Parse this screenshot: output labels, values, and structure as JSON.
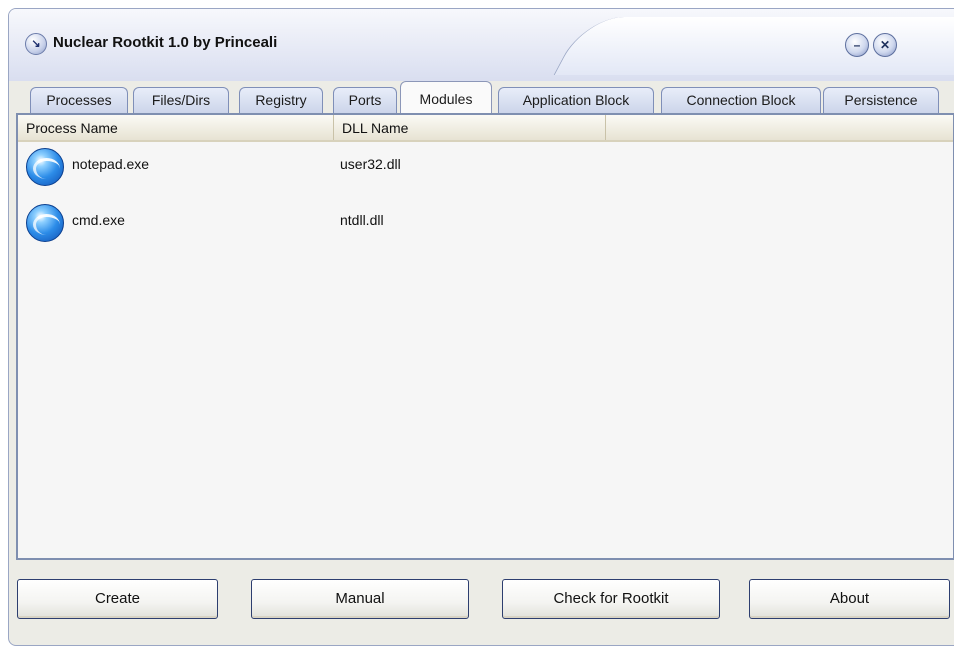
{
  "window": {
    "title": "Nuclear Rootkit 1.0 by Princeali"
  },
  "titlebar": {
    "app_icon": "arrow-down-icon",
    "minimize_icon": "minimize-icon",
    "close_icon": "close-icon"
  },
  "tabs": [
    {
      "label": "Processes",
      "active": false
    },
    {
      "label": "Files/Dirs",
      "active": false
    },
    {
      "label": "Registry",
      "active": false
    },
    {
      "label": "Ports",
      "active": false
    },
    {
      "label": "Modules",
      "active": true
    },
    {
      "label": "Application Block",
      "active": false
    },
    {
      "label": "Connection Block",
      "active": false
    },
    {
      "label": "Persistence",
      "active": false
    }
  ],
  "table": {
    "columns": [
      "Process Name",
      "DLL Name"
    ],
    "rows": [
      {
        "icon": "globe-icon",
        "process_name": "notepad.exe",
        "dll_name": "user32.dll"
      },
      {
        "icon": "globe-icon",
        "process_name": "cmd.exe",
        "dll_name": "ntdll.dll"
      }
    ]
  },
  "buttons": {
    "create": "Create",
    "manual": "Manual",
    "check_for_rootkit": "Check for Rootkit",
    "about": "About"
  },
  "colors": {
    "window_border": "#9aa6c4",
    "tab_border": "#7f8fb8",
    "header_background": "#e7e3d3",
    "content_background": "#f6f6f6"
  }
}
